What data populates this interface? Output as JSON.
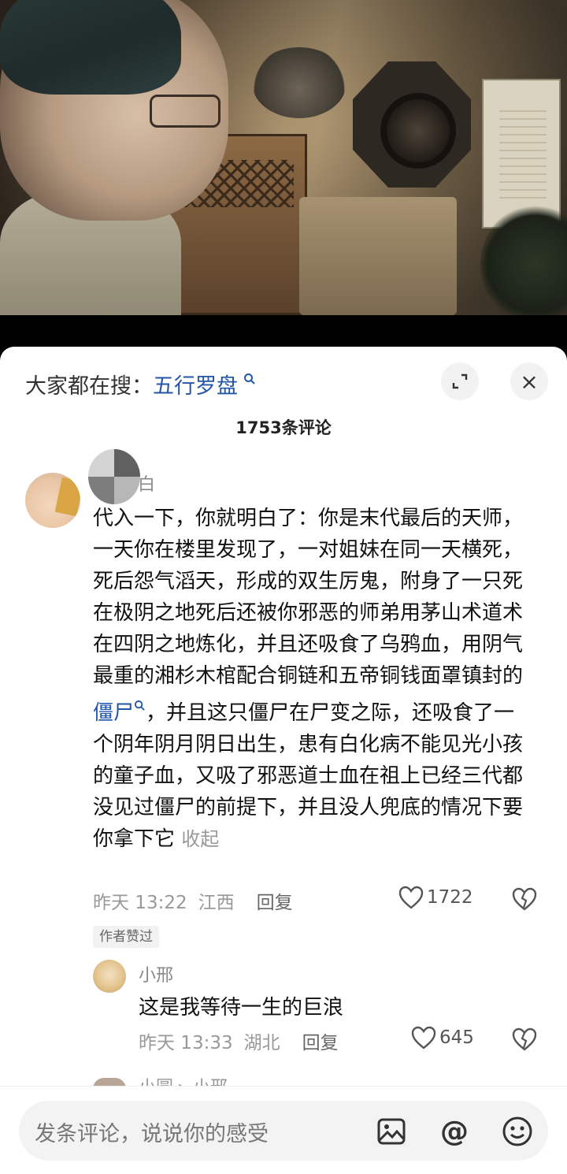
{
  "search": {
    "prefix": "大家都在搜：",
    "keyword": "五行罗盘",
    "search_icon": "search-icon"
  },
  "header": {
    "comment_count": "1753条评论",
    "expand_icon": "expand-icon",
    "close_icon": "close-icon",
    "close_glyph": "×"
  },
  "comment": {
    "name_tail": "白",
    "text_1": "代入一下，你就明白了：你是末代最后的天师，一天你在楼里发现了，一对姐妹在同一天横死，死后怨气滔天，形成的双生厉鬼，附身了一只死在极阴之地死后还被你邪恶的师弟用茅山术道术在四阴之地炼化，并且还吸食了乌鸦血，用阴气最重的湘杉木棺配合铜链和五帝铜钱面罩镇封的",
    "link": "僵尸",
    "text_2": "，并且这只僵尸在尸变之际，还吸食了一个阴年阴月阴日出生，患有白化病不能见光小孩的童子血，又吸了邪恶道士血在祖上已经三代都没见过僵尸的前提下，并且没人兜底的情况下要你拿下它",
    "collapse": "收起",
    "time": "昨天 13:22",
    "location": "江西",
    "reply": "回复",
    "likes": "1722",
    "author_badge": "作者赞过"
  },
  "reply": {
    "name": "小邢",
    "text": "这是我等待一生的巨浪",
    "time": "昨天 13:33",
    "location": "湖北",
    "reply": "回复",
    "likes": "645"
  },
  "partial": {
    "name": "小圆 ▸ 小邢"
  },
  "input": {
    "placeholder": "发条评论，说说你的感受",
    "at_glyph": "@"
  }
}
